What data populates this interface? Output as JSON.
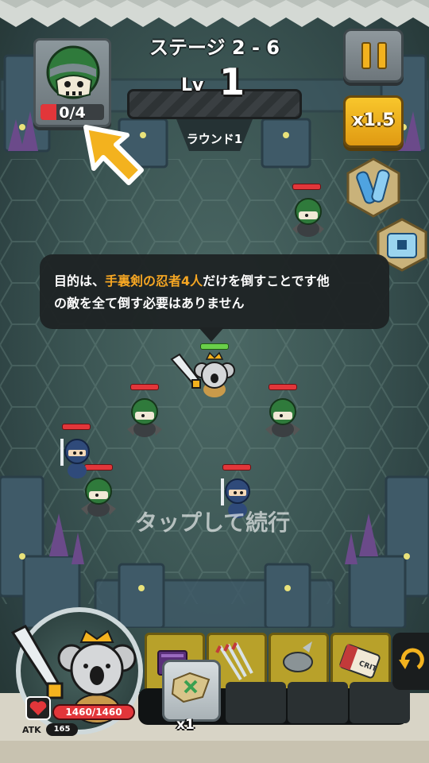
{
  "hud": {
    "stage_title": "ステージ 2 - 6",
    "level_prefix": "Lv",
    "level_value": "1",
    "round_label": "ラウンド1",
    "target_count": "0/4",
    "target_progress": 0.0,
    "speed_label": "x1.5"
  },
  "tooltip": {
    "part1": "目的は、",
    "highlight": "手裏剣の忍者4人",
    "part2": "だけを倒すことです他",
    "line2": "の敵を全て倒す必要はありません"
  },
  "tap_hint": "タップして続行",
  "hero": {
    "hp_text": "1460/1460",
    "atk_label": "ATK",
    "atk_value": "165"
  },
  "inventory": {
    "item_quantity": "x1",
    "skill_tags": [
      "CRIT"
    ]
  },
  "colors": {
    "accent_gold": "#f3b21e",
    "hp_red": "#e2363a",
    "highlight_orange": "#f5a623",
    "enemy_green": "#2f7a3b",
    "ninja_blue": "#2f4a7a"
  },
  "icons": {
    "target": "skull-bandana-icon",
    "pause": "pause-icon",
    "speed": "fast-forward-icon",
    "scroll": "scroll-icon",
    "chest": "treasure-chest-icon",
    "heart": "heart-icon",
    "reroll": "refresh-arrow-icon"
  }
}
